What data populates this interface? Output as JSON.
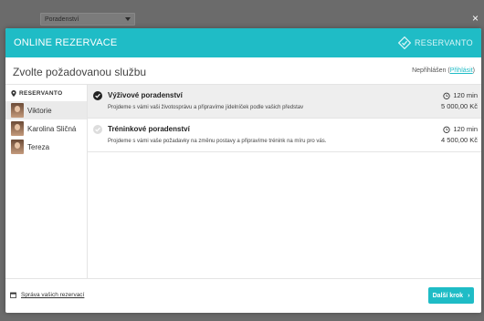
{
  "backdrop": {
    "select_value": "Poradenství",
    "close_label": "×"
  },
  "modal": {
    "title": "ONLINE REZERVACE",
    "brand": "RESERVANTO",
    "section_title": "Zvolte požadovanou službu",
    "login_status": "Nepřihlášen",
    "login_link": "Přihlásit",
    "accent_color": "#1fbcc6"
  },
  "sidebar": {
    "heading": "RESERVANTO",
    "staff": [
      {
        "name": "Viktorie"
      },
      {
        "name": "Karolina Sličná"
      },
      {
        "name": "Tereza"
      }
    ]
  },
  "services": [
    {
      "name": "Výživové poradenství",
      "description": "Projdeme s vámi vaši životosprávu a připravíme jídelníček podle vašich představ",
      "duration": "120 min",
      "price": "5 000,00 Kč",
      "selected": true
    },
    {
      "name": "Tréninkové poradenství",
      "description": "Projdeme s vámi vaše požadavky na změnu postavy a připravíme trénink na míru pro vás.",
      "duration": "120 min",
      "price": "4 500,00 Kč",
      "selected": false
    }
  ],
  "footer": {
    "manage_link": "Správa vašich rezervací",
    "next_button": "Další krok",
    "next_arrow": "›"
  }
}
